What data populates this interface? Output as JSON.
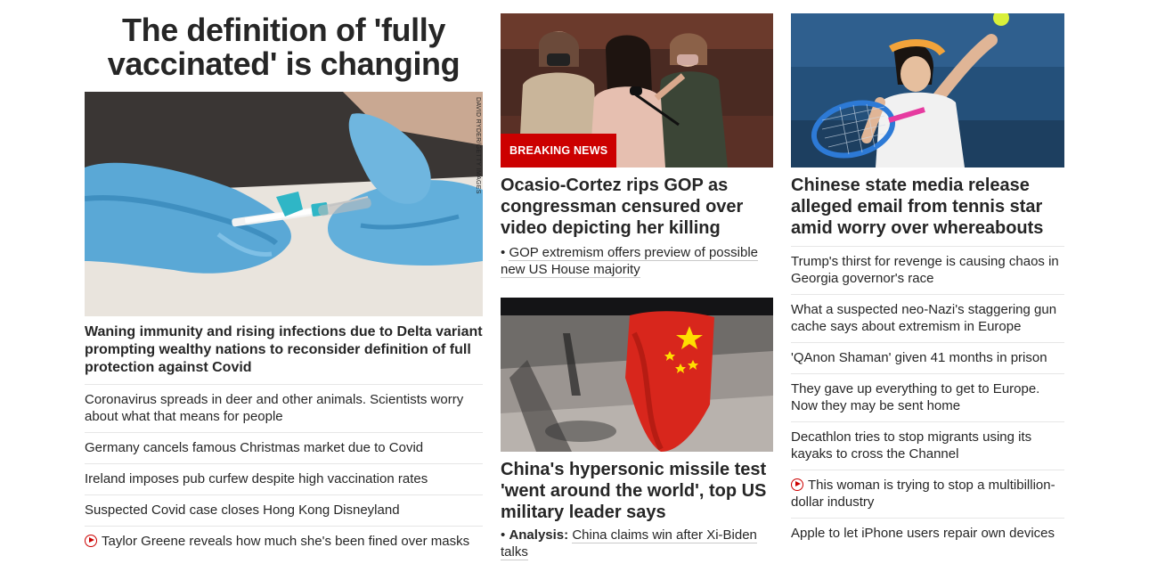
{
  "left": {
    "main_title": "The definition of 'fully vaccinated' is changing",
    "image_credit": "DAVID RYDER/GETTY IMAGES",
    "headline": "Waning immunity and rising infections due to Delta variant prompting wealthy nations to reconsider definition of full protection against Covid",
    "links": [
      "Coronavirus spreads in deer and other animals. Scientists worry about what that means for people",
      "Germany cancels famous Christmas market due to Covid",
      "Ireland imposes pub curfew despite high vaccination rates",
      "Suspected Covid case closes Hong Kong Disneyland",
      "Taylor Greene reveals how much she's been fined over masks"
    ]
  },
  "middle": {
    "story1": {
      "badge": "BREAKING NEWS",
      "headline": "Ocasio-Cortez rips GOP as congressman censured over video depicting her killing",
      "sub_bullet": "•",
      "sub": "GOP extremism offers preview of possible new US House majority"
    },
    "story2": {
      "headline": "China's hypersonic missile test 'went around the world', top US military leader says",
      "sub_bullet": "•",
      "sub_prefix": "Analysis:",
      "sub": "China claims win after Xi-Biden talks"
    }
  },
  "right": {
    "headline": "Chinese state media release alleged email from tennis star amid worry over whereabouts",
    "links": [
      "Trump's thirst for revenge is causing chaos in Georgia governor's race",
      "What a suspected neo-Nazi's staggering gun cache says about extremism in Europe",
      "'QAnon Shaman' given 41 months in prison",
      "They gave up everything to get to Europe. Now they may be sent home",
      "Decathlon tries to stop migrants using its kayaks to cross the Channel",
      "This woman is trying to stop a multibillion-dollar industry",
      "Apple to let iPhone users repair own devices"
    ]
  },
  "colors": {
    "accent": "#cc0000",
    "text": "#262626",
    "divider": "#e6e6e6"
  },
  "icons": {
    "video": "play-circle-icon"
  }
}
